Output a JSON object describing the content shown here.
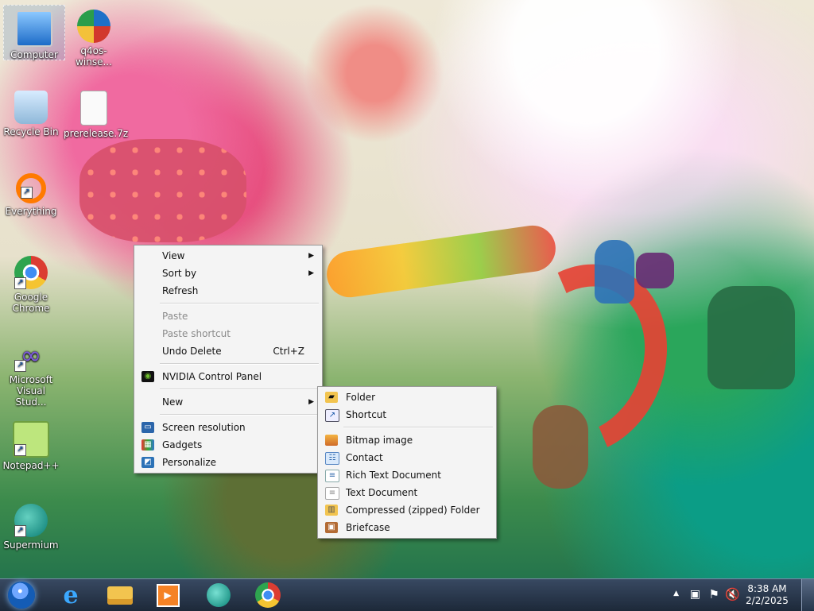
{
  "desktop": {
    "icons": [
      {
        "label": "Computer"
      },
      {
        "label": "q4os-winse..."
      },
      {
        "label": "Recycle Bin"
      },
      {
        "label": "prerelease.7z"
      },
      {
        "label": "Everything"
      },
      {
        "label": "Google Chrome"
      },
      {
        "label": "Microsoft Visual Stud..."
      },
      {
        "label": "Notepad++"
      },
      {
        "label": "Supermium"
      }
    ]
  },
  "context_menu": {
    "view": "View",
    "sort_by": "Sort by",
    "refresh": "Refresh",
    "paste": "Paste",
    "paste_shortcut": "Paste shortcut",
    "undo_delete": "Undo Delete",
    "undo_shortcut": "Ctrl+Z",
    "nvidia": "NVIDIA Control Panel",
    "new": "New",
    "screen_resolution": "Screen resolution",
    "gadgets": "Gadgets",
    "personalize": "Personalize"
  },
  "new_submenu": {
    "folder": "Folder",
    "shortcut": "Shortcut",
    "bitmap": "Bitmap image",
    "contact": "Contact",
    "rich_text": "Rich Text Document",
    "text": "Text Document",
    "compressed": "Compressed (zipped) Folder",
    "briefcase": "Briefcase"
  },
  "taskbar": {
    "clock_time": "8:38 AM",
    "clock_date": "2/2/2025",
    "icons": [
      "start-orb-icon",
      "internet-explorer-icon",
      "file-explorer-icon",
      "media-player-icon",
      "supermium-icon",
      "chrome-icon"
    ]
  },
  "colors": {
    "menu_background": "#f4f4f4",
    "taskbar": "#1d2939",
    "selection": "#3f78c8"
  }
}
